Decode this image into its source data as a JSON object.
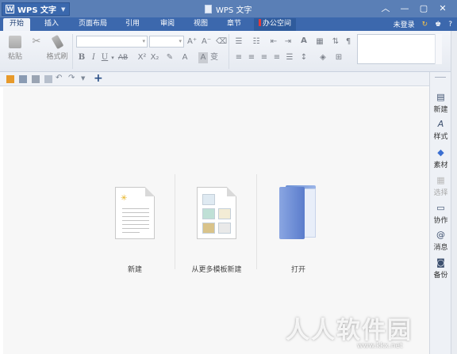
{
  "app": {
    "menu_logo": "W",
    "menu_label": "WPS 文字",
    "window_title": "WPS 文字"
  },
  "tabs": [
    {
      "label": "开始",
      "active": true
    },
    {
      "label": "插入"
    },
    {
      "label": "页面布局"
    },
    {
      "label": "引用"
    },
    {
      "label": "审阅"
    },
    {
      "label": "视图"
    },
    {
      "label": "章节"
    },
    {
      "label": "办公空间"
    }
  ],
  "account": {
    "login_label": "未登录",
    "help_label": "?"
  },
  "ribbon": {
    "paste_label": "粘贴",
    "format_painter_label": "格式刷",
    "bold": "B",
    "italic": "I",
    "underline": "U",
    "strikethrough": "AB",
    "superscript": "X²",
    "subscript": "X₂",
    "grow_font": "A⁺",
    "shrink_font": "A⁻",
    "font_color": "A",
    "text_effect": "A",
    "pinyin": "变"
  },
  "start_page": {
    "new_label": "新建",
    "from_template_label": "从更多模板新建",
    "open_label": "打开"
  },
  "sidebar": [
    {
      "label": "新建",
      "icon": "new-doc-icon",
      "glyph": "▤"
    },
    {
      "label": "样式",
      "icon": "style-icon",
      "glyph": "A"
    },
    {
      "label": "素材",
      "icon": "material-icon",
      "glyph": "◆"
    },
    {
      "label": "选择",
      "icon": "select-icon",
      "glyph": "▦",
      "disabled": true
    },
    {
      "label": "协作",
      "icon": "collab-icon",
      "glyph": "▭"
    },
    {
      "label": "消息",
      "icon": "message-icon",
      "glyph": "@"
    },
    {
      "label": "备份",
      "icon": "backup-icon",
      "glyph": "◙"
    }
  ],
  "watermark": {
    "text": "人人软件园",
    "url": "www.kkx.net"
  },
  "colors": {
    "title_bar": "#5a7fb6",
    "tab_bar": "#3c68ad",
    "office_space_mark": "#e23b3b"
  }
}
